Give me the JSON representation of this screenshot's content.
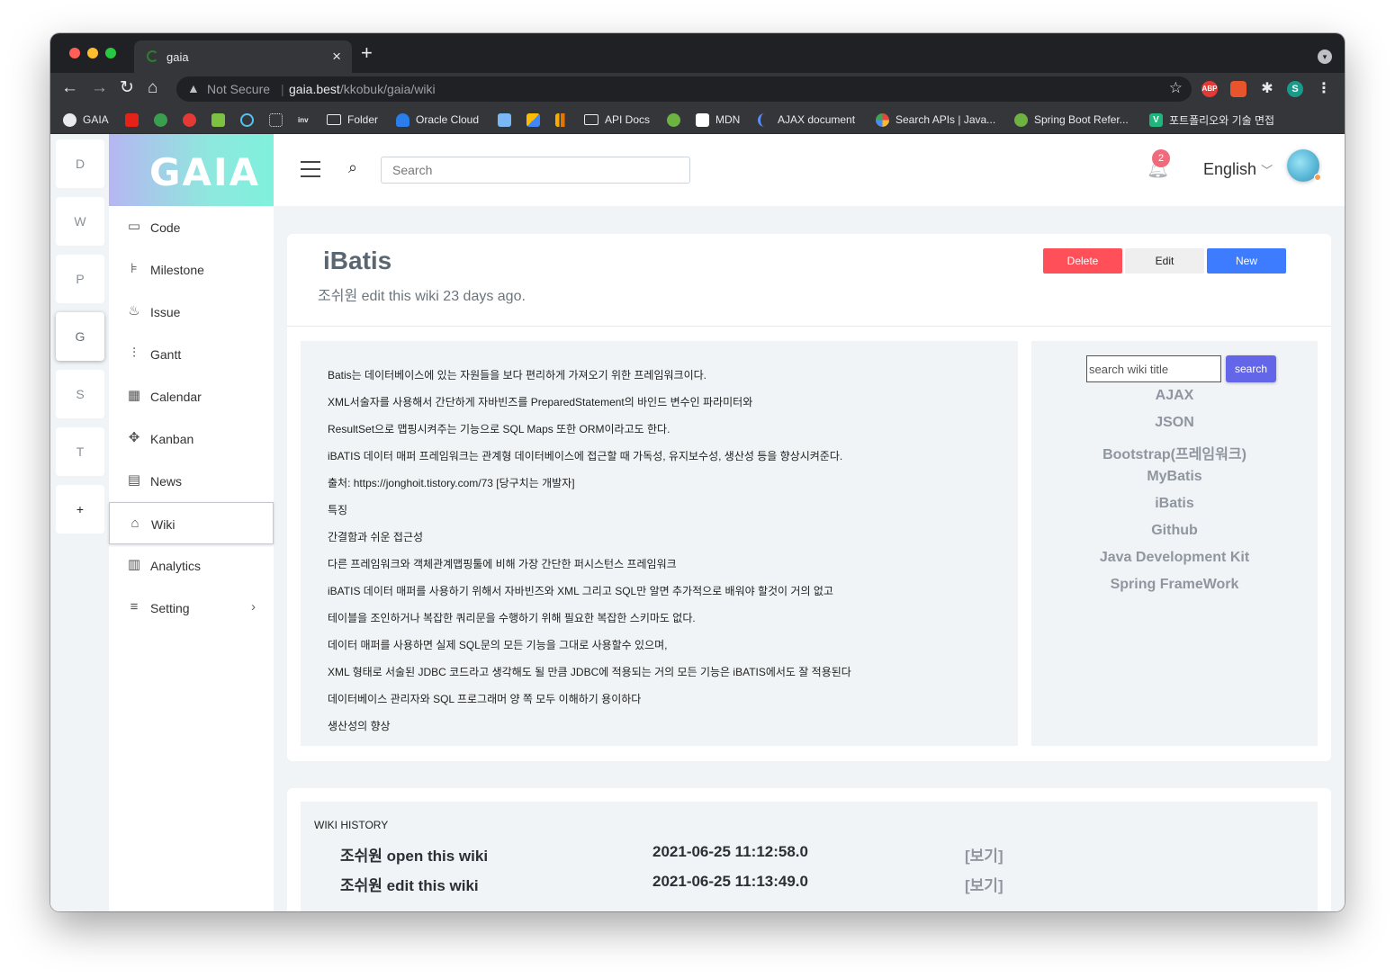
{
  "browser": {
    "tab_title": "gaia",
    "new_tab": "+",
    "close": "×",
    "security": "Not Secure",
    "separator": "|",
    "url_host": "gaia.best",
    "url_path": "/kkobuk/gaia/wiki",
    "profile_initial": "S",
    "ext_abp": "ABP"
  },
  "bookmarks": [
    "GAIA",
    "Folder",
    "Oracle Cloud",
    "API Docs",
    "MDN",
    "AJAX document",
    "Search APIs | Java...",
    "Spring Boot Refer...",
    "포트폴리오와 기술 면접"
  ],
  "rail": [
    "D",
    "W",
    "P",
    "G",
    "S",
    "T",
    "+"
  ],
  "sidebar": {
    "logo": "GAIA",
    "items": [
      {
        "label": "Code",
        "icon": "monitor-icon"
      },
      {
        "label": "Milestone",
        "icon": "signpost-icon"
      },
      {
        "label": "Issue",
        "icon": "fire-icon"
      },
      {
        "label": "Gantt",
        "icon": "sliders-icon"
      },
      {
        "label": "Calendar",
        "icon": "calendar-icon"
      },
      {
        "label": "Kanban",
        "icon": "move-icon"
      },
      {
        "label": "News",
        "icon": "book-icon"
      },
      {
        "label": "Wiki",
        "icon": "graduation-cap-icon"
      },
      {
        "label": "Analytics",
        "icon": "bar-chart-icon"
      },
      {
        "label": "Setting",
        "icon": "menu-icon"
      }
    ]
  },
  "header": {
    "search_placeholder": "Search",
    "notification_count": "2",
    "language": "English"
  },
  "wiki": {
    "title": "iBatis",
    "subtitle": "조쉬원 edit this wiki 23 days ago.",
    "delete_label": "Delete",
    "edit_label": "Edit",
    "new_label": "New",
    "paragraphs": [
      "Batis는 데이터베이스에 있는 자원들을 보다 편리하게 가져오기 위한 프레임워크이다.",
      "XML서술자를 사용해서 간단하게 자바빈즈를 PreparedStatement의 바인드 변수인 파라미터와",
      "ResultSet으로 맵핑시켜주는 기능으로 SQL Maps 또한 ORM이라고도 한다.",
      "iBATIS 데이터 매퍼 프레임워크는 관계형 데이터베이스에 접근할 때 가독성, 유지보수성, 생산성 등을 향상시켜준다.",
      "출처: https://jonghoit.tistory.com/73 [당구치는 개발자]",
      "특징",
      "간결함과 쉬운 접근성",
      "다른 프레임워크와 객체관계맵핑툴에 비해 가장 간단한 퍼시스턴스 프레임워크",
      "iBATIS 데이터 매퍼를 사용하기 위해서 자바빈즈와 XML 그리고 SQL만 알면 추가적으로 배워야 할것이 거의 없고",
      "테이블을 조인하거나 복잡한 쿼리문을 수행하기 위해 필요한 복잡한 스키마도 없다.",
      "데이터 매퍼를 사용하면 실제 SQL문의 모든 기능을 그대로 사용할수 있으며,",
      "XML 형태로 서술된 JDBC 코드라고 생각해도 될 만큼 JDBC에 적용되는 거의 모든 기능은 iBATIS에서도 잘 적용된다",
      "데이터베이스 관리자와 SQL 프로그래머 양 쪽 모두 이해하기 용이하다",
      "생산성의 향상"
    ],
    "side_search_placeholder": "search wiki title",
    "side_search_button": "search",
    "links": [
      "AJAX",
      "JSON",
      "Bootstrap(프레임워크)",
      "MyBatis",
      "iBatis",
      "Github",
      "Java Development Kit",
      "Spring FrameWork"
    ]
  },
  "history": {
    "title": "WIKI HISTORY",
    "rows": [
      {
        "action": "조쉬원 open this wiki",
        "time": "2021-06-25 11:12:58.0",
        "link": "[보기]"
      },
      {
        "action": "조쉬원 edit this wiki",
        "time": "2021-06-25 11:13:49.0",
        "link": "[보기]"
      }
    ]
  },
  "colors": {
    "delete": "#ff5059",
    "new": "#3d7cff",
    "accent": "#6366e9"
  }
}
